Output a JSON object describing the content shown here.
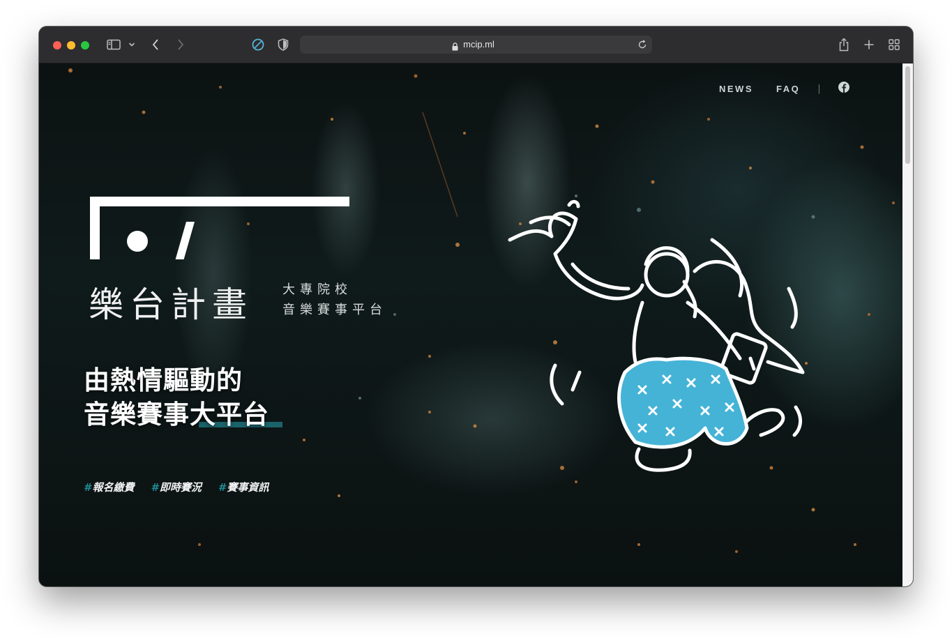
{
  "browser": {
    "url": "mcip.ml",
    "icons": [
      "sidebar-icon",
      "chevron-down-icon",
      "back-icon",
      "forward-icon",
      "privacy-icon",
      "shield-icon",
      "lock-icon",
      "reload-icon",
      "share-icon",
      "plus-icon",
      "tabs-grid-icon"
    ]
  },
  "nav": {
    "items": [
      "NEWS",
      "FAQ"
    ],
    "separator": "|",
    "social_icon": "facebook-icon"
  },
  "brand": {
    "title": "樂台計畫",
    "subtitle_line1": "大專院校",
    "subtitle_line2": "音樂賽事平台"
  },
  "hero": {
    "headline_line1": "由熱情驅動的",
    "headline_line2": "音樂賽事大平台",
    "tags": [
      "報名繳費",
      "即時賽況",
      "賽事資訊"
    ],
    "hash": "#"
  },
  "colors": {
    "accent": "#1f8a94",
    "illustration_fill": "#45b3d6"
  }
}
